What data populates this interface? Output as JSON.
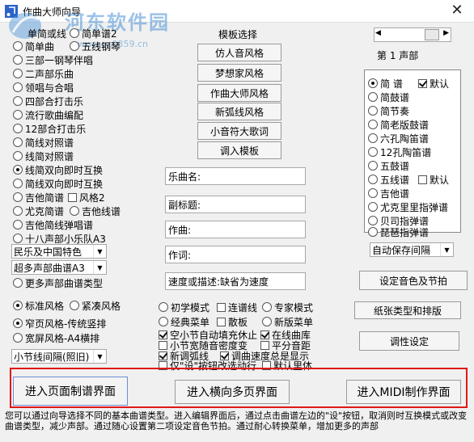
{
  "window": {
    "title": "作曲大师向导",
    "close_glyph": "✕"
  },
  "watermark": {
    "name": "河东软件园",
    "url": "www.pc0359.cn"
  },
  "left_options": [
    {
      "label": "单简或线",
      "checked": false
    },
    {
      "label": "简单谱2",
      "checked": false
    },
    {
      "label": "简单曲",
      "checked": false
    },
    {
      "label": "五线钢琴",
      "checked": false
    },
    {
      "label": "三部一钢琴伴唱",
      "checked": false
    },
    {
      "label": "二声部乐曲",
      "checked": false
    },
    {
      "label": "领唱与合唱",
      "checked": false
    },
    {
      "label": "四部合打击乐",
      "checked": false
    },
    {
      "label": "流行歌曲编配",
      "checked": false
    },
    {
      "label": "12部合打击乐",
      "checked": false
    },
    {
      "label": "简线对照谱",
      "checked": false
    },
    {
      "label": "线简对照谱",
      "checked": false
    },
    {
      "label": "线简双向即时互换",
      "checked": true
    },
    {
      "label": "简线双向即时互换",
      "checked": false
    },
    {
      "label": "吉他简谱",
      "checked": false
    },
    {
      "label": "风格2",
      "checked": false
    },
    {
      "label": "尤克简谱",
      "checked": false
    },
    {
      "label": "吉他线谱",
      "checked": false
    },
    {
      "label": "吉他简线弹唱谱",
      "checked": false
    },
    {
      "label": "十八声部小乐队A3",
      "checked": false
    }
  ],
  "dropdowns": {
    "style": "民乐及中国特色",
    "multi": "超多声部曲谱A3",
    "autosave": "自动保存间隔",
    "bar_spacing": "小节线间隔(照旧)"
  },
  "more_parts": "更多声部曲谱类型",
  "style_radios": [
    {
      "label": "标准风格",
      "checked": true
    },
    {
      "label": "紧凑风格",
      "checked": false
    }
  ],
  "width_radios": [
    {
      "label": "窄页风格-传统竖排",
      "checked": true
    },
    {
      "label": "宽屏风格-A4横排",
      "checked": false
    }
  ],
  "template": {
    "heading": "模板选择",
    "buttons": [
      "仿人音风格",
      "梦想家风格",
      "作曲大师风格",
      "新弧线风格",
      "小音符大歌词",
      "调入模板"
    ]
  },
  "fields": [
    {
      "label": "乐曲名:",
      "value": ""
    },
    {
      "label": "副标题:",
      "value": ""
    },
    {
      "label": "作曲:",
      "value": ""
    },
    {
      "label": "作词:",
      "value": ""
    },
    {
      "label": "速度或描述:缺省为速度",
      "value": ""
    }
  ],
  "mode_radios": [
    {
      "label": "初学模式",
      "checked": false
    },
    {
      "label": "专家模式",
      "checked": false
    }
  ],
  "options": [
    {
      "label": "连谱线",
      "checked": false
    },
    {
      "label": "经典菜单",
      "checked": false
    },
    {
      "label": "散板",
      "checked": false
    },
    {
      "label": "新版菜单",
      "checked": false
    },
    {
      "label": "空小节自动填充休止",
      "checked": true
    },
    {
      "label": "在线曲库",
      "checked": true
    },
    {
      "label": "小节宽随音密度变",
      "checked": false
    },
    {
      "label": "平分音距",
      "checked": false
    },
    {
      "label": "新调弧线",
      "checked": true
    },
    {
      "label": "调曲速度总是显示",
      "checked": true
    },
    {
      "label": "仅\"设\"按钮改选动行",
      "checked": false
    },
    {
      "label": "默认里体",
      "checked": false
    }
  ],
  "right": {
    "part_label": "第 1 声部",
    "scroll_left": "◀",
    "scroll_right": "▶",
    "listbox": [
      {
        "label": "简  谱",
        "checked": true
      },
      {
        "label": "简鼓谱",
        "checked": false
      },
      {
        "label": "简节奏",
        "checked": false
      },
      {
        "label": "简老版鼓谱",
        "checked": false
      },
      {
        "label": "六孔陶笛谱",
        "checked": false
      },
      {
        "label": "12孔陶笛谱",
        "checked": false
      },
      {
        "label": "五鼓谱",
        "checked": false
      },
      {
        "label": "五线谱",
        "checked": false
      },
      {
        "label": "吉他谱",
        "checked": false
      },
      {
        "label": "尤克里里指弹谱",
        "checked": false
      },
      {
        "label": "贝司指弹谱",
        "checked": false
      },
      {
        "label": "琵琶指弹谱",
        "checked": false
      }
    ],
    "default_a": "默认",
    "default_b": "默认",
    "buttons": {
      "color": "设定音色及节拍",
      "paper": "纸张类型和排版",
      "tune": "调性设定"
    }
  },
  "bottom_buttons": [
    "进入页面制谱界面",
    "进入横向多页界面",
    "进入MIDI制作界面"
  ],
  "status": "您可以通过向导选择不同的基本曲谱类型。进入编辑界面后，通过点击曲谱左边的\"设\"按钮，取消则时互换模式或改变曲谱类型，减少声部。通过随心设置第二项设定音色节拍。通过耐心转换菜单，增加更多的声部"
}
